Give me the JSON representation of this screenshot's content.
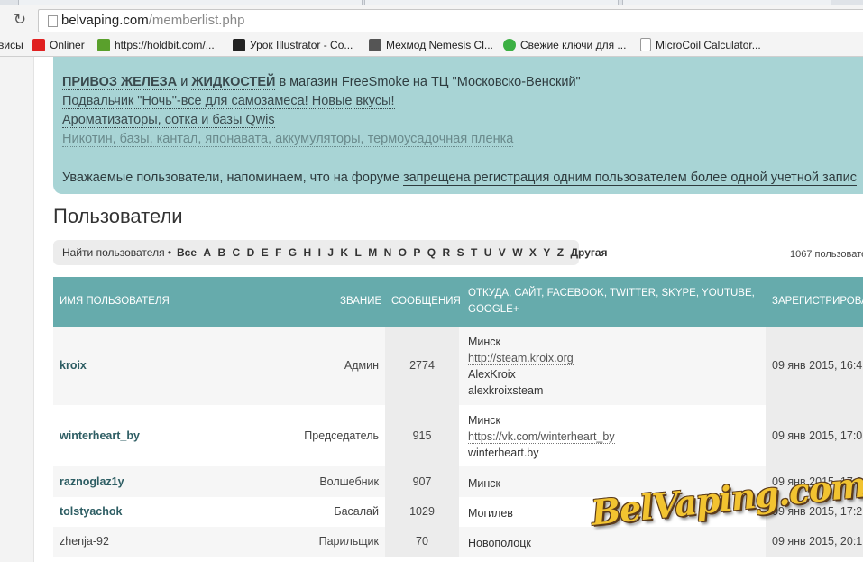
{
  "browser": {
    "url_host": "belvaping.com",
    "url_path": "/memberlist.php",
    "bookmarks": [
      {
        "label": "висы",
        "icon": "bookmark-fragment-icon",
        "color": "#f4f4f4"
      },
      {
        "label": "Onliner",
        "icon": "onliner-icon",
        "color": "#e02020"
      },
      {
        "label": "https://holdbit.com/...",
        "icon": "holdbit-cube-icon",
        "color": "#5aa02c"
      },
      {
        "label": "Урок Illustrator - Co...",
        "icon": "illustrator-icon",
        "color": "#222222"
      },
      {
        "label": "Мехмод Nemesis Cl...",
        "icon": "e-letter-icon",
        "color": "#555555"
      },
      {
        "label": "Свежие ключи для ...",
        "icon": "green-circle-icon",
        "color": "#3cb043"
      },
      {
        "label": "MicroCoil Calculator...",
        "icon": "page-icon",
        "color": "#ffffff"
      }
    ]
  },
  "notice": {
    "line1_a": "ПРИВОЗ ЖЕЛЕЗА",
    "line1_b": " и ",
    "line1_c": "ЖИДКОСТЕЙ",
    "line1_d": " в магазин FreeSmoke на ТЦ \"Московско-Венский\"",
    "line2": "Подвальчик \"Ночь\"-все для самозамеса! Новые вкусы!",
    "line3": "Ароматизаторы, сотка и базы Qwis",
    "line4": "Никотин, базы, кантал, японавата, аккумуляторы, термоусадочная пленка",
    "line5_a": "Уважаемые пользователи, напоминаем, что на форуме ",
    "line5_b": "запрещена регистрация одним пользователем более одной учетной запис"
  },
  "page": {
    "title": "Пользователи",
    "finder_label": "Найти пользователя •",
    "letters": [
      "Все",
      "A",
      "B",
      "C",
      "D",
      "E",
      "F",
      "G",
      "H",
      "I",
      "J",
      "K",
      "L",
      "M",
      "N",
      "O",
      "P",
      "Q",
      "R",
      "S",
      "T",
      "U",
      "V",
      "W",
      "X",
      "Y",
      "Z",
      "Другая"
    ],
    "count": "1067 пользовате"
  },
  "table": {
    "headers": {
      "name": "Имя пользователя",
      "rank": "Звание",
      "posts": "Сообщения",
      "from_1": "Откуда, сайт, Facebook, Twitter, Skype, YouTube,",
      "from_2": "Google+",
      "registered": "Зарегистрирова"
    },
    "rows": [
      {
        "name": "kroix",
        "rank": "Админ",
        "posts": "2774",
        "from": [
          "Минск",
          "http://steam.kroix.org",
          "AlexKroix",
          "alexkroixsteam"
        ],
        "date": "09 янв 2015, 16:4"
      },
      {
        "name": "winterheart_by",
        "rank": "Председатель",
        "posts": "915",
        "from": [
          "Минск",
          "https://vk.com/winterheart_by",
          "winterheart.by"
        ],
        "date": "09 янв 2015, 17:0"
      },
      {
        "name": "raznoglaz1y",
        "rank": "Волшебник",
        "posts": "907",
        "from": [
          "Минск"
        ],
        "date": "09 янв 2015, 17:2"
      },
      {
        "name": "tolstyachok",
        "rank": "Басалай",
        "posts": "1029",
        "from": [
          "Могилев"
        ],
        "date": "09 янв 2015, 17:2"
      },
      {
        "name": "zhenja-92",
        "rank": "Парильщик",
        "posts": "70",
        "from": [
          "Новополоцк"
        ],
        "date": "09 янв 2015, 20:1"
      }
    ]
  },
  "watermark": "BelVaping.com"
}
